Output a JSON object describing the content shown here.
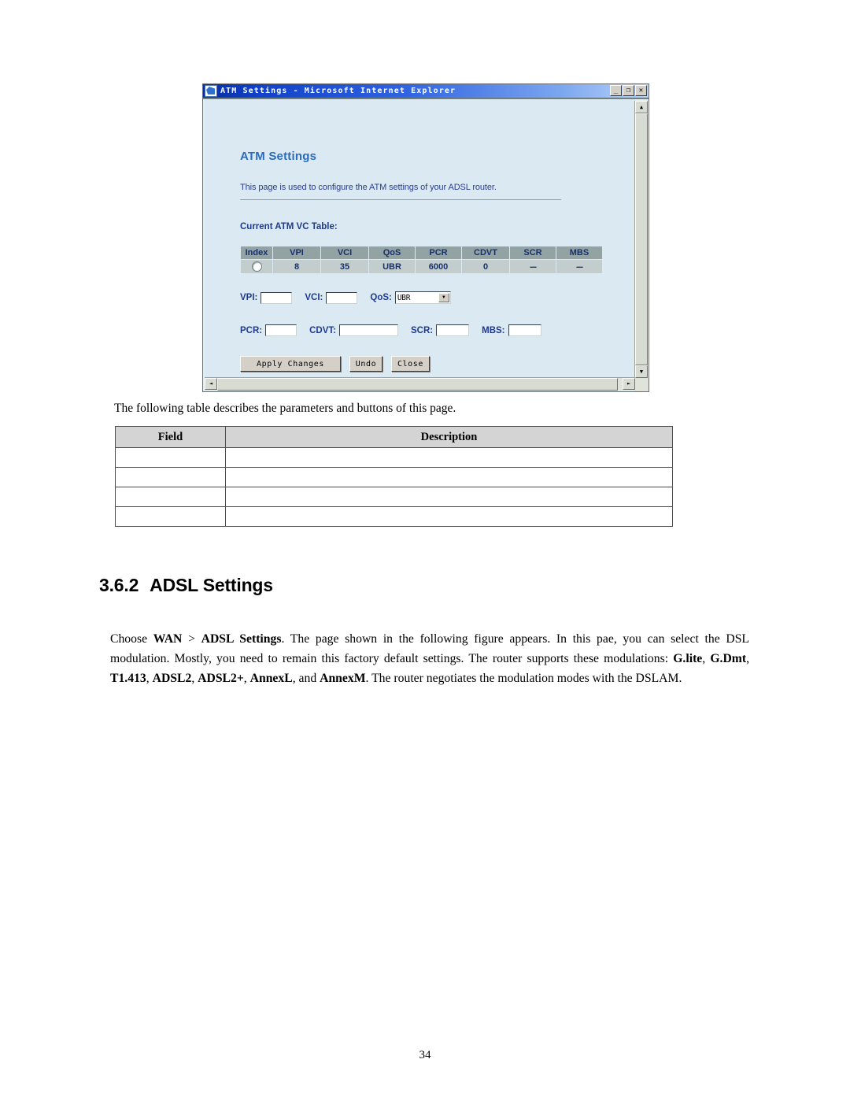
{
  "browser": {
    "title": "ATM Settings - Microsoft Internet Explorer",
    "controls": {
      "minimize": "_",
      "maximize": "❐",
      "close": "✕"
    },
    "scrollbar": {
      "up": "▲",
      "down": "▼",
      "left": "◄",
      "right": "►"
    }
  },
  "atm_page": {
    "heading": "ATM Settings",
    "description": "This page is used to configure the ATM settings of your ADSL router.",
    "table_label": "Current ATM VC Table:",
    "vc_table": {
      "columns": [
        "Index",
        "VPI",
        "VCI",
        "QoS",
        "PCR",
        "CDVT",
        "SCR",
        "MBS"
      ],
      "rows": [
        {
          "index_selected": true,
          "vpi": "8",
          "vci": "35",
          "qos": "UBR",
          "pcr": "6000",
          "cdvt": "0",
          "scr": "---",
          "mbs": "---"
        }
      ]
    },
    "form": {
      "vpi_label": "VPI:",
      "vpi_value": "",
      "vci_label": "VCI:",
      "vci_value": "",
      "qos_label": "QoS:",
      "qos_value": "UBR",
      "qos_arrow": "▼",
      "pcr_label": "PCR:",
      "pcr_value": "",
      "cdvt_label": "CDVT:",
      "cdvt_value": "",
      "scr_label": "SCR:",
      "scr_value": "",
      "mbs_label": "MBS:",
      "mbs_value": ""
    },
    "buttons": {
      "apply": "Apply Changes",
      "undo": "Undo",
      "close": "Close"
    }
  },
  "document": {
    "intro_line": "The following table describes the parameters and buttons of this page.",
    "desc_table": {
      "headers": [
        "Field",
        "Description"
      ],
      "rows": [
        {
          "field": "",
          "description": ""
        },
        {
          "field": "",
          "description": ""
        },
        {
          "field": "",
          "description": ""
        },
        {
          "field": "",
          "description": ""
        }
      ]
    },
    "section": {
      "number": "3.6.2",
      "title": "ADSL Settings"
    },
    "paragraph": {
      "p1": "Choose ",
      "b1": "WAN",
      "p2": " > ",
      "b2": "ADSL Settings",
      "p3": ". The page shown in the following figure appears. In this pae, you can select the DSL modulation. Mostly, you need to remain this factory default settings. The router supports these modulations: ",
      "b3": "G.lite",
      "p4": ", ",
      "b4": "G.Dmt",
      "p5": ", ",
      "b5": "T1.413",
      "p6": ", ",
      "b6": "ADSL2",
      "p7": ", ",
      "b7": "ADSL2+",
      "p8": ", ",
      "b8": "AnnexL",
      "p9": ", and ",
      "b9": "AnnexM",
      "p10": ". The router negotiates the modulation modes with the DSLAM."
    },
    "page_number": "34"
  },
  "colors": {
    "ie_title_blue": "#1041c8",
    "page_bg": "#dbeaf2",
    "heading_blue": "#2b6bbf",
    "label_navy": "#1e3a8f",
    "table_header_gray": "#93a3a3",
    "table_cell_gray": "#c3cdcd",
    "button_face": "#d4d0c8",
    "doc_table_header": "#d4d4d4"
  }
}
